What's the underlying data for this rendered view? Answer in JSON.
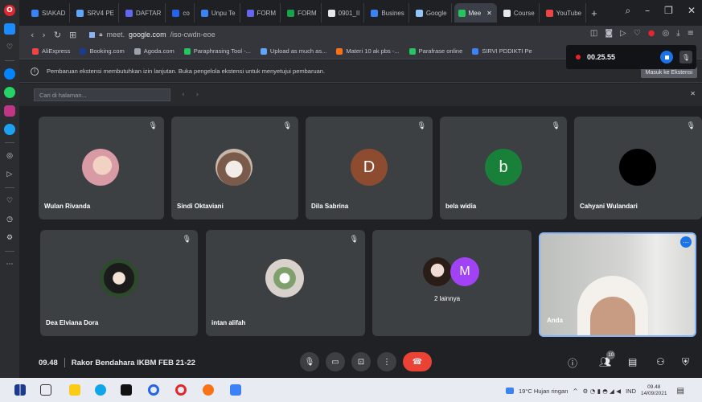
{
  "browser": {
    "tabs": [
      {
        "label": "SIAKAD",
        "color": "#3b82f6"
      },
      {
        "label": "SRV4 PE",
        "color": "#60a5fa"
      },
      {
        "label": "DAFTAR",
        "color": "#6366f1"
      },
      {
        "label": "co",
        "color": "#2563eb"
      },
      {
        "label": "Unpu Te",
        "color": "#3b82f6"
      },
      {
        "label": "FORM",
        "color": "#6366f1"
      },
      {
        "label": "FORM",
        "color": "#16a34a"
      },
      {
        "label": "0901_II",
        "color": "#e5e7eb"
      },
      {
        "label": "Busines",
        "color": "#3b82f6"
      },
      {
        "label": "Google",
        "color": "#93c5fd"
      },
      {
        "label": "Mee",
        "color": "#22c55e",
        "active": true
      },
      {
        "label": "Course",
        "color": "#e5e7eb"
      },
      {
        "label": "YouTube",
        "color": "#ef4444"
      }
    ],
    "url_prefix": "meet.",
    "url_domain": "google.com",
    "url_path": "/iso-cwdn-eoe",
    "bookmarks": [
      {
        "label": "AliExpress",
        "color": "#ef4444"
      },
      {
        "label": "Booking.com",
        "color": "#1e3a8a"
      },
      {
        "label": "Agoda.com",
        "color": "#9ca3af"
      },
      {
        "label": "Paraphrasing Tool -...",
        "color": "#22c55e"
      },
      {
        "label": "Upload as much as...",
        "color": "#60a5fa"
      },
      {
        "label": "Materi 10 ak pbs -...",
        "color": "#f97316"
      },
      {
        "label": "Parafrase online",
        "color": "#22c55e"
      },
      {
        "label": "SIRVI PDDIKTI Pe",
        "color": "#3b82f6"
      }
    ],
    "info_text": "Pembaruan ekstensi membutuhkan izin lanjutan. Buka pengelola ekstensi untuk menyetujui pembaruan.",
    "info_button": "Masuk ke Ekstensi",
    "find_placeholder": "Cari di halaman..."
  },
  "recording": {
    "time": "00.25.55"
  },
  "participants": [
    {
      "name": "Wulan Rivanda",
      "kind": "photo",
      "photo_color": "#d89aa5"
    },
    {
      "name": "Sindi Oktaviani",
      "kind": "photo",
      "photo_color": "#c8b6a8"
    },
    {
      "name": "Dila Sabrina",
      "kind": "initial",
      "initial": "D",
      "color": "#8d4b2f"
    },
    {
      "name": "bela widia",
      "kind": "initial",
      "initial": "b",
      "color": "#188038"
    },
    {
      "name": "Cahyani Wulandari",
      "kind": "photo",
      "photo_color": "#000000"
    },
    {
      "name": "Dea Elviana Dora",
      "kind": "photo",
      "photo_color": "#2d4a2b"
    },
    {
      "name": "intan alifah",
      "kind": "photo",
      "photo_color": "#b9cbb2"
    },
    {
      "name": "2 lainnya",
      "kind": "group",
      "initial": "M",
      "color": "#a142f4"
    }
  ],
  "self": {
    "name": "Anda"
  },
  "meeting": {
    "time": "09.48",
    "title": "Rakor Bendahara IKBM FEB 21-22",
    "people_count": "10"
  },
  "taskbar": {
    "weather": "19°C  Hujan ringan",
    "lang": "IND",
    "clock_time": "09.48",
    "clock_date": "14/09/2021"
  }
}
